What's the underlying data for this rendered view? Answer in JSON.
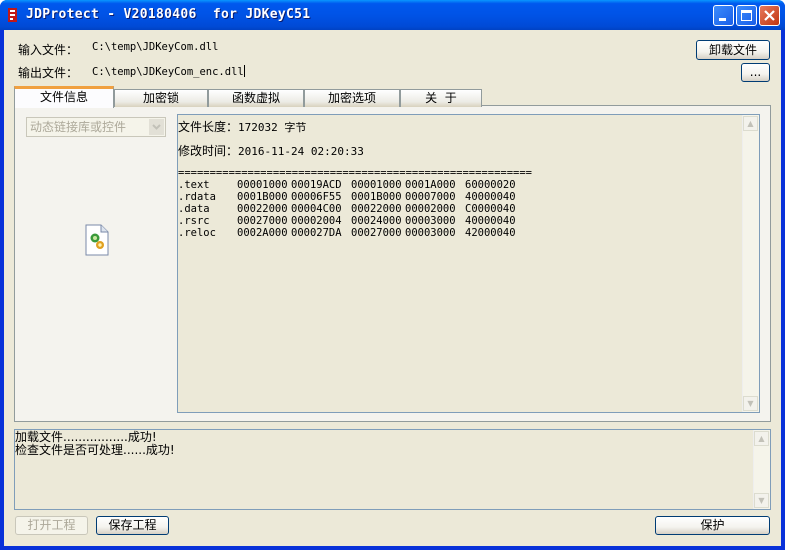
{
  "window": {
    "title": "JDProtect - V20180406  for JDKeyC51"
  },
  "files": {
    "input_label": "输入文件：",
    "input_value": "C:\\temp\\JDKeyCom.dll",
    "output_label": "输出文件：",
    "output_value": "C:\\temp\\JDKeyCom_enc.dll",
    "unload_button": "卸载文件",
    "browse_button": "..."
  },
  "tabs": [
    {
      "label": "文件信息",
      "active": true
    },
    {
      "label": "加密锁"
    },
    {
      "label": "函数虚拟"
    },
    {
      "label": "加密选项"
    },
    {
      "label": "关  于"
    }
  ],
  "file_info": {
    "type_select": "动态链接库或控件",
    "icon": "dll-file-icon",
    "length_label": "文件长度：",
    "length_value": "172032 字节",
    "modified_label": "修改时间：",
    "modified_value": "2016-11-24 02:20:33",
    "separator": "========================================================",
    "sections": [
      [
        ".text",
        "00001000",
        "00019ACD",
        "00001000",
        "0001A000",
        "60000020"
      ],
      [
        ".rdata",
        "0001B000",
        "00006F55",
        "0001B000",
        "00007000",
        "40000040"
      ],
      [
        ".data",
        "00022000",
        "00004C00",
        "00022000",
        "00002000",
        "C0000040"
      ],
      [
        ".rsrc",
        "00027000",
        "00002004",
        "00024000",
        "00003000",
        "40000040"
      ],
      [
        ".reloc",
        "0002A000",
        "000027DA",
        "00027000",
        "00003000",
        "42000040"
      ]
    ]
  },
  "log": [
    "加载文件.................成功!",
    "检查文件是否可处理......成功!"
  ],
  "bottom": {
    "open_project": "打开工程",
    "save_project": "保存工程",
    "protect": "保护"
  }
}
